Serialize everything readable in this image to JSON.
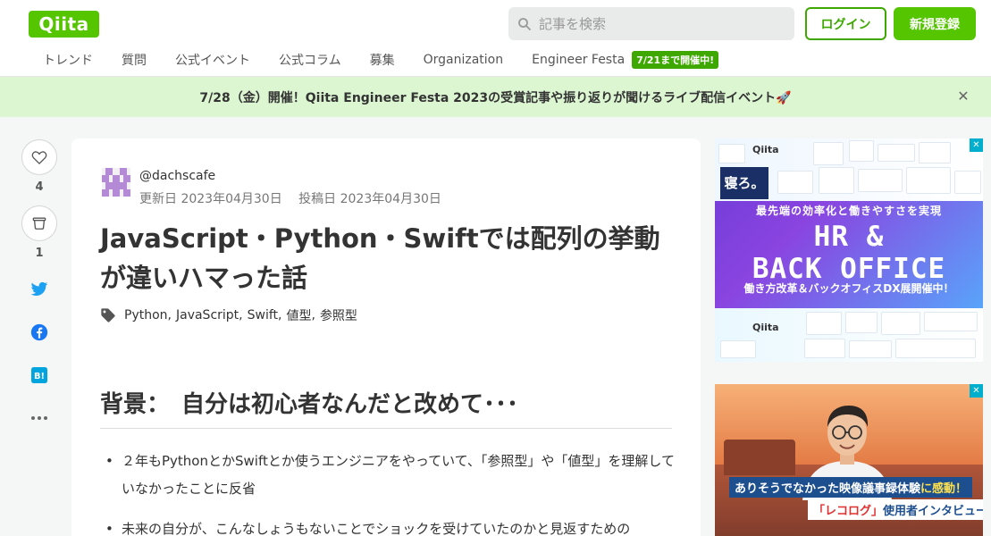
{
  "header": {
    "logo": "Qiita",
    "search_placeholder": "記事を検索",
    "login_label": "ログイン",
    "signup_label": "新規登録"
  },
  "nav": {
    "items": [
      "トレンド",
      "質問",
      "公式イベント",
      "公式コラム",
      "募集",
      "Organization",
      "Engineer Festa"
    ],
    "badge": "7/21まで開催中!"
  },
  "banner": {
    "text": "7/28（金）開催！Qiita Engineer Festa 2023の受賞記事や振り返りが聞けるライブ配信イベント🚀",
    "close_icon": "close-icon"
  },
  "sidebar": {
    "like_count": "4",
    "stock_count": "1",
    "icons": [
      "heart-icon",
      "stock-icon",
      "twitter-icon",
      "facebook-icon",
      "hatena-bookmark-icon",
      "more-icon"
    ]
  },
  "article": {
    "author": "@dachscafe",
    "updated": "更新日 2023年04月30日",
    "posted": "投稿日 2023年04月30日",
    "title": "JavaScript・Python・Swiftでは配列の挙動が違いハマった話",
    "tags": [
      "Python",
      "JavaScript",
      "Swift",
      "値型",
      "参照型"
    ],
    "section_heading": "背景：　自分は初心者なんだと改めて･･･",
    "bullets": [
      "２年もPythonとかSwiftとか使うエンジニアをやっていて、「参照型」や「値型」を理解していなかったことに反省",
      "未来の自分が、こんなしょうもないことでショックを受けていたのかと見返すための"
    ]
  },
  "ads": {
    "ad1": {
      "logo": "Qiita",
      "sleep_label": "寝ろ。",
      "headline": "最先端の効率化と働きやすさを実現",
      "big_line1": "HR &",
      "big_line2": "BACK OFFICE",
      "sub": "働き方改革＆バックオフィスDX展開催中！",
      "ribbon": "✕"
    },
    "ad2": {
      "line1_prefix": "ありそうでなかった映像議事録体験",
      "line1_em": "に感動！",
      "line2_em": "「レコログ」",
      "line2_suffix": "使用者インタビュー",
      "ribbon": "✕"
    }
  },
  "colors": {
    "brand": "#55c500",
    "brand_dark": "#3ea800",
    "banner_bg": "#dcf6d2",
    "twitter": "#1da1f2",
    "facebook": "#1877f2",
    "hatena": "#00a4de"
  }
}
